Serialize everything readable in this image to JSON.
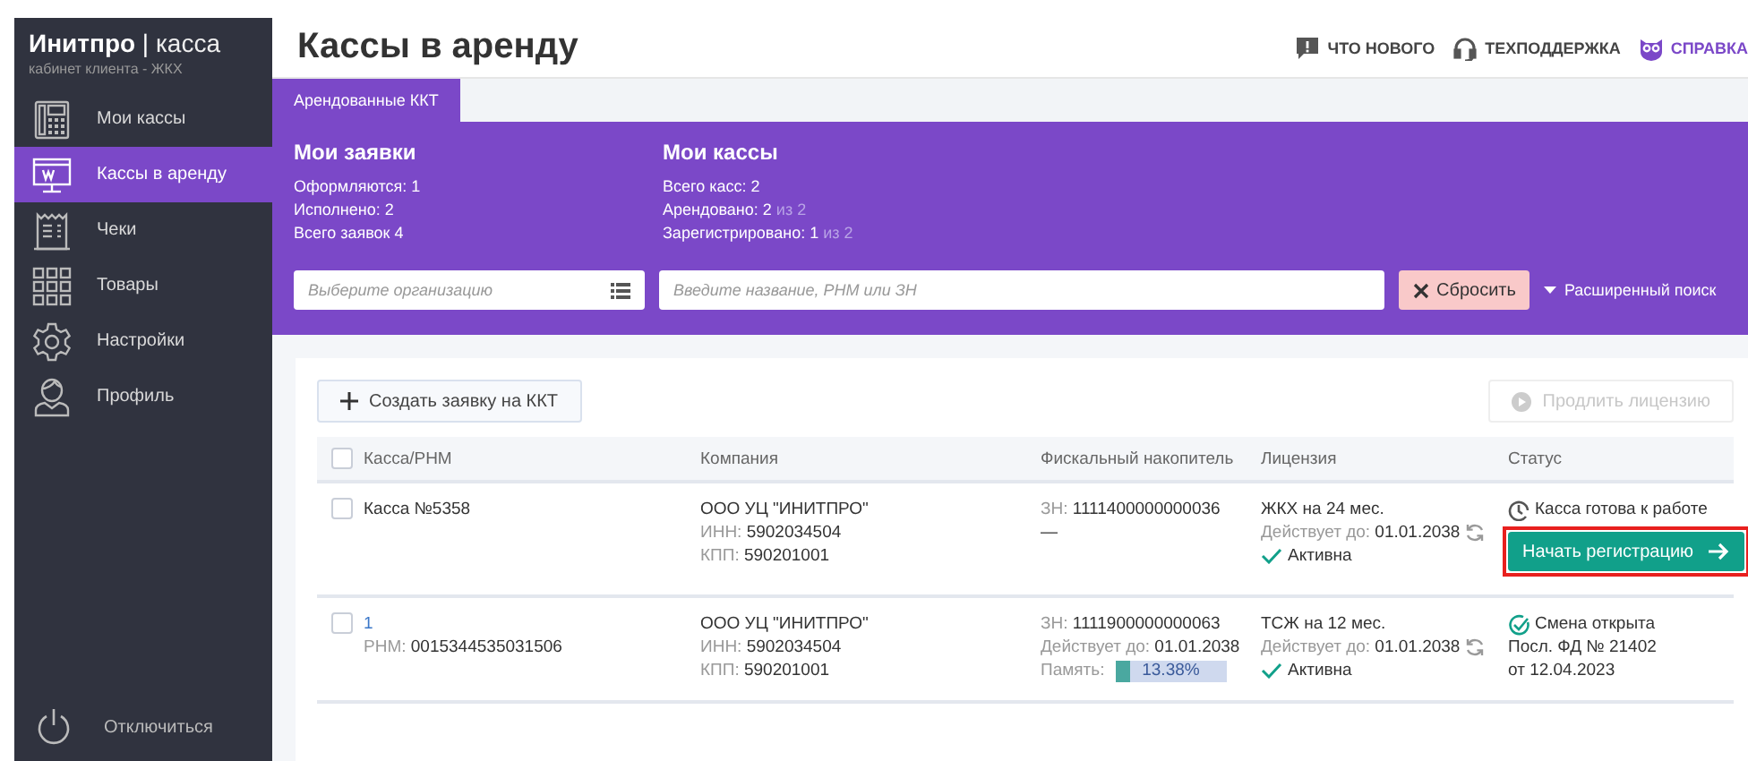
{
  "brand": {
    "name": "Инитпро",
    "separator": "|",
    "product": "касса",
    "subtitle": "кабинет клиента - ЖКХ"
  },
  "sidebar": {
    "items": [
      {
        "label": "Мои кассы",
        "kind": "register",
        "selected": false
      },
      {
        "label": "Кассы в аренду",
        "kind": "monitor",
        "selected": true
      },
      {
        "label": "Чеки",
        "kind": "receipt",
        "selected": false
      },
      {
        "label": "Товары",
        "kind": "grid",
        "selected": false
      },
      {
        "label": "Настройки",
        "kind": "gear",
        "selected": false
      },
      {
        "label": "Профиль",
        "kind": "person",
        "selected": false
      }
    ],
    "logout": {
      "label": "Отключиться"
    }
  },
  "page_title": "Кассы в аренду",
  "header_links": [
    {
      "label": "ЧТО НОВОГО",
      "kind": "news"
    },
    {
      "label": "ТЕХПОДДЕРЖКА",
      "kind": "support"
    },
    {
      "label": "СПРАВКА",
      "kind": "help"
    }
  ],
  "tabs": [
    {
      "label": "Арендованные ККТ",
      "selected": true
    }
  ],
  "summary": [
    {
      "title": "Мои заявки",
      "lines": [
        {
          "text": "Оформляются: 1"
        },
        {
          "text": "Исполнено: 2"
        },
        {
          "text": "Всего заявок 4"
        }
      ]
    },
    {
      "title": "Мои кассы",
      "lines": [
        {
          "text": "Всего касс: 2"
        },
        {
          "text": "Арендовано: 2",
          "muted": "из 2"
        },
        {
          "text": "Зарегистрировано: 1",
          "muted": "из 2"
        }
      ]
    }
  ],
  "filters": {
    "organization": {
      "placeholder": "Выберите организацию"
    },
    "search": {
      "placeholder": "Введите название, РНМ или ЗН"
    },
    "reset": "Сбросить",
    "advanced": "Расширенный поиск"
  },
  "toolbar": {
    "create": "Создать заявку на ККТ",
    "extend": {
      "label": "Продлить лицензию",
      "disabled": true
    }
  },
  "table": {
    "columns": [
      "Касса/РНМ",
      "Компания",
      "Фискальный накопитель",
      "Лицензия",
      "Статус"
    ],
    "all_checked": false,
    "rows": [
      {
        "checked": false,
        "register": {
          "name": "Касса №5358",
          "link": false
        },
        "company": {
          "name": "ООО УЦ \"ИНИТПРО\"",
          "fields": [
            {
              "label": "ИНН:",
              "value": "5902034504"
            },
            {
              "label": "КПП:",
              "value": "590201001"
            }
          ]
        },
        "fiscal": {
          "fields": [
            {
              "label": "ЗН:",
              "value": "1111400000000036"
            },
            {
              "value": "—"
            }
          ]
        },
        "license": {
          "plan": "ЖКХ на 24 мес.",
          "valid_label": "Действует до:",
          "valid": "01.01.2038",
          "state": "Активна"
        },
        "status": {
          "kind": "ready",
          "text": "Касса готова к работе",
          "action": {
            "label": "Начать регистрацию",
            "highlighted": true
          }
        }
      },
      {
        "checked": false,
        "register": {
          "name": "1",
          "link": true,
          "rnm_label": "РНМ:",
          "rnm": "0015344535031506"
        },
        "company": {
          "name": "ООО УЦ \"ИНИТПРО\"",
          "fields": [
            {
              "label": "ИНН:",
              "value": "5902034504"
            },
            {
              "label": "КПП:",
              "value": "590201001"
            }
          ]
        },
        "fiscal": {
          "fields": [
            {
              "label": "ЗН:",
              "value": "1111900000000063"
            },
            {
              "label": "Действует до:",
              "value": "01.01.2038"
            }
          ],
          "memory": {
            "label": "Память:",
            "level": 0.1338,
            "reading": "13.38%"
          }
        },
        "license": {
          "plan": "ТСЖ на 12 мес.",
          "valid_label": "Действует до:",
          "valid": "01.01.2038",
          "state": "Активна"
        },
        "status": {
          "kind": "open",
          "text": "Смена открыта",
          "lines": [
            "Посл. ФД № 21402",
            "от 12.04.2023"
          ]
        }
      }
    ]
  }
}
